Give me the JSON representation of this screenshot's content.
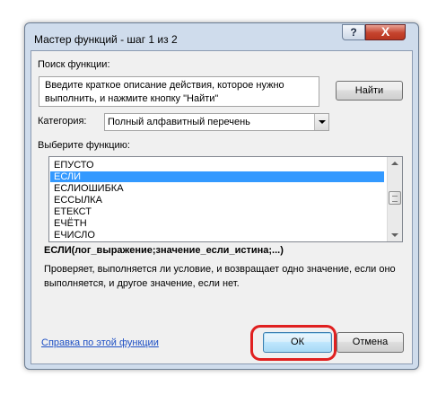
{
  "window": {
    "title": "Мастер функций - шаг 1 из 2",
    "help_glyph": "?",
    "close_glyph": "X"
  },
  "search": {
    "label": "Поиск функции:",
    "value": "Введите краткое описание действия, которое нужно\nвыполнить, и нажмите кнопку \"Найти\"",
    "find_button": "Найти"
  },
  "category": {
    "label": "Категория:",
    "selected": "Полный алфавитный перечень"
  },
  "function_list": {
    "label": "Выберите функцию:",
    "items": [
      "ЕПУСТО",
      "ЕСЛИ",
      "ЕСЛИОШИБКА",
      "ЕССЫЛКА",
      "ЕТЕКСТ",
      "ЕЧЁТН",
      "ЕЧИСЛО"
    ],
    "selected_index": 1
  },
  "details": {
    "signature": "ЕСЛИ(лог_выражение;значение_если_истина;...)",
    "description": "Проверяет, выполняется ли условие, и возвращает одно значение, если оно выполняется, и другое значение, если нет."
  },
  "footer": {
    "help_link": "Справка по этой функции",
    "ok_label": "ОК",
    "cancel_label": "Отмена"
  },
  "colors": {
    "selection": "#3399ff",
    "highlight": "#e02020",
    "link": "#1d4fc4"
  }
}
